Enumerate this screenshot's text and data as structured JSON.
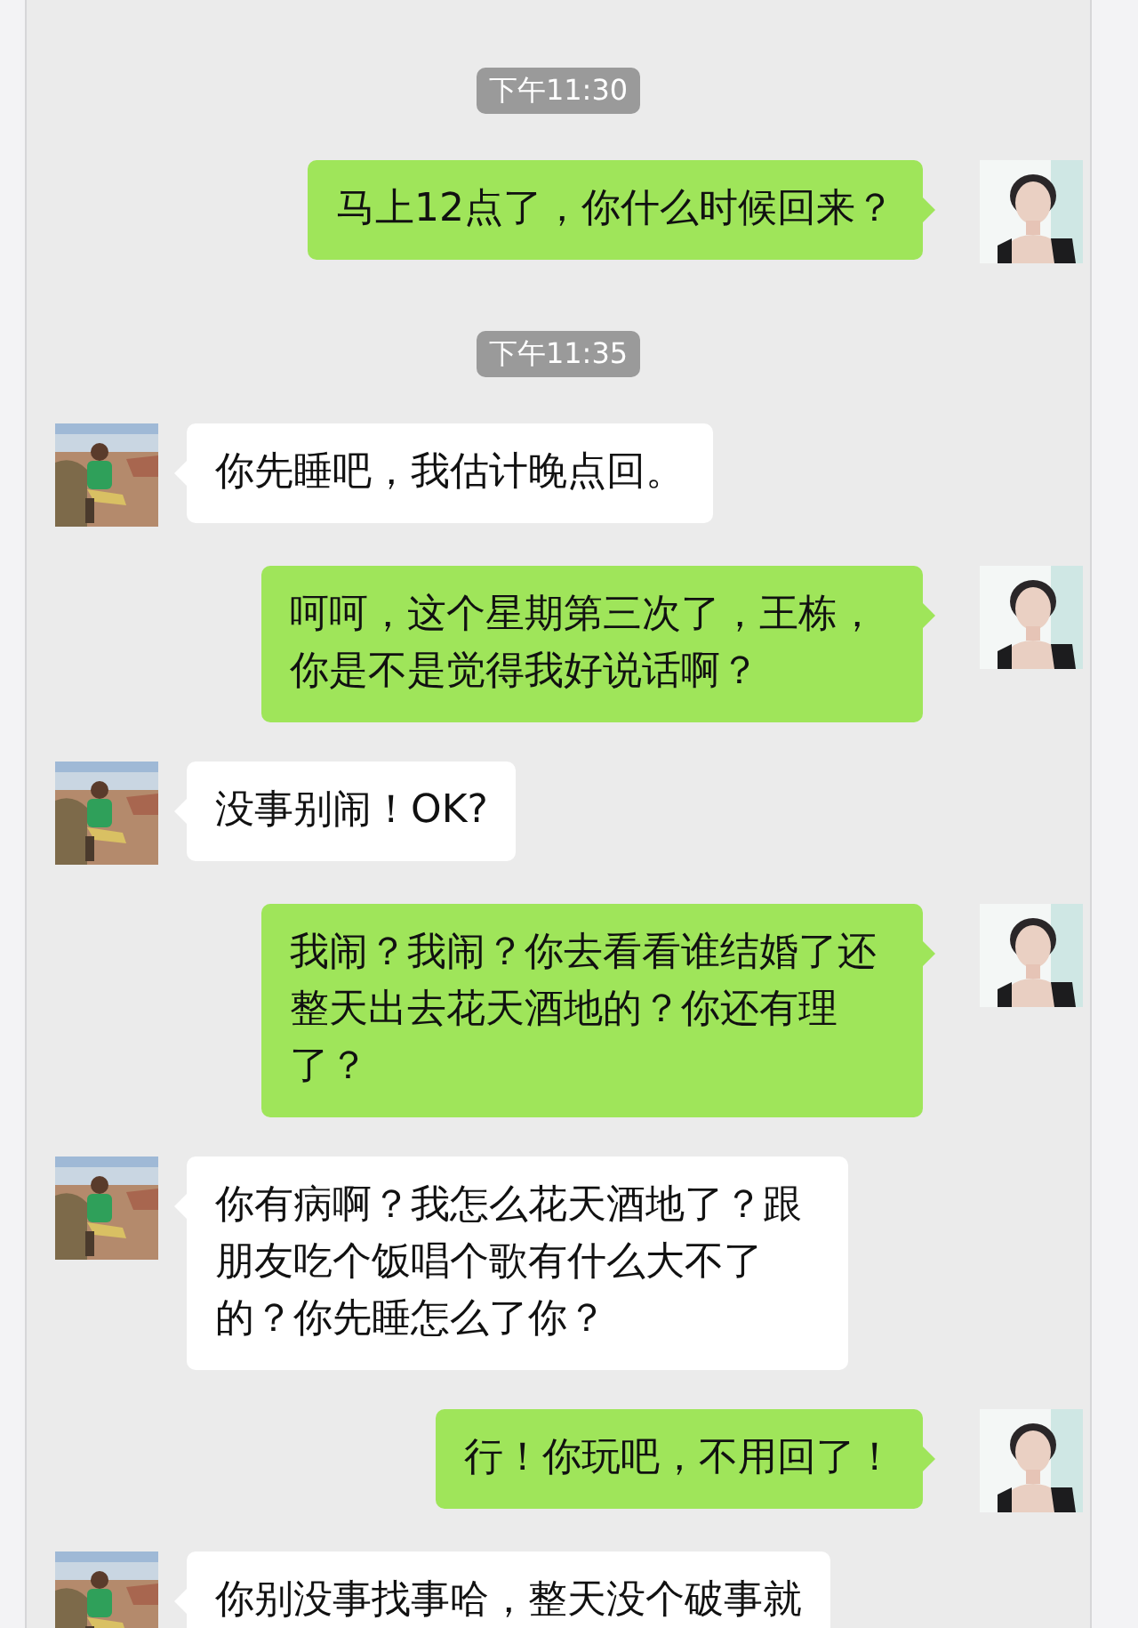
{
  "messages": [
    {
      "kind": "time",
      "text": "下午11:30"
    },
    {
      "kind": "sent",
      "text": "马上12点了，你什么时候回来？"
    },
    {
      "kind": "time",
      "text": "下午11:35"
    },
    {
      "kind": "received",
      "text": "你先睡吧，我估计晚点回。"
    },
    {
      "kind": "sent",
      "text": "呵呵，这个星期第三次了，王栋，你是不是觉得我好说话啊？"
    },
    {
      "kind": "received",
      "text": "没事别闹！OK?"
    },
    {
      "kind": "sent",
      "text": "我闹？我闹？你去看看谁结婚了还整天出去花天酒地的？你还有理了？"
    },
    {
      "kind": "received",
      "text": "你有病啊？我怎么花天酒地了？跟朋友吃个饭唱个歌有什么大不了的？你先睡怎么了你？"
    },
    {
      "kind": "sent",
      "text": "行！你玩吧，不用回了！"
    },
    {
      "kind": "received",
      "text": "你别没事找事哈，整天没个破事就"
    }
  ]
}
